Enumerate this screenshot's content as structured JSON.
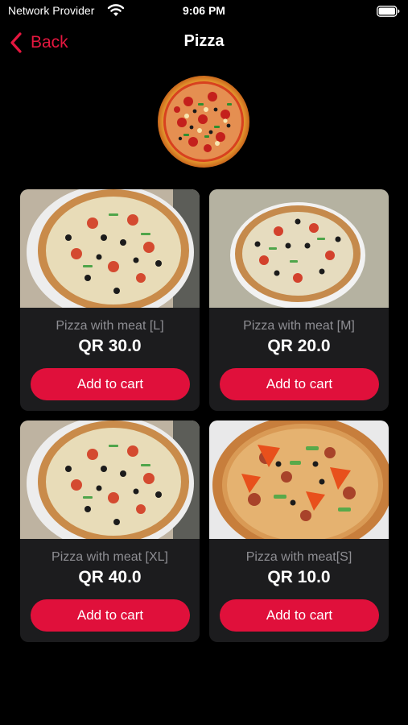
{
  "status_bar": {
    "carrier": "Network Provider",
    "time": "9:06 PM",
    "wifi_icon": "wifi-icon",
    "battery_icon": "battery-icon"
  },
  "nav": {
    "back_label": "Back",
    "back_icon": "chevron-left-icon",
    "title": "Pizza"
  },
  "colors": {
    "accent": "#e0103b",
    "card_bg": "#1c1c1e",
    "muted_text": "#8e8e93",
    "background": "#000000"
  },
  "products": [
    {
      "name": "Pizza with meat [L]",
      "price": "QR 30.0",
      "button_label": "Add to cart"
    },
    {
      "name": "Pizza with meat [M]",
      "price": "QR 20.0",
      "button_label": "Add to cart"
    },
    {
      "name": "Pizza with meat [XL]",
      "price": "QR 40.0",
      "button_label": "Add to cart"
    },
    {
      "name": "Pizza with meat[S]",
      "price": "QR 10.0",
      "button_label": "Add to cart"
    }
  ]
}
